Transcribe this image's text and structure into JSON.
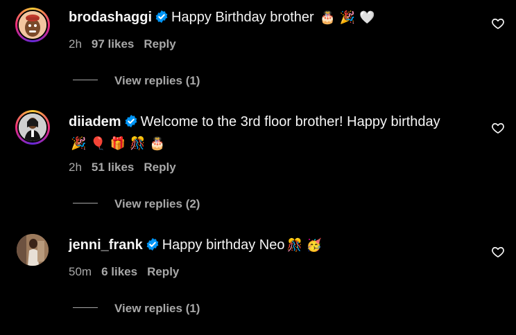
{
  "comments": [
    {
      "username": "brodashaggi",
      "verified": true,
      "text": "Happy Birthday brother",
      "emojis": [
        "🎂",
        "🎉",
        "🤍"
      ],
      "time": "2h",
      "likes": "97 likes",
      "reply_label": "Reply",
      "view_replies": "View replies (1)",
      "avatar_icon": "cartoon-avatar"
    },
    {
      "username": "diiadem",
      "verified": true,
      "text": "Welcome to the 3rd floor brother! Happy birthday",
      "emojis": [
        "🎉",
        "🎈",
        "🎁",
        "🎊",
        "🎂"
      ],
      "time": "2h",
      "likes": "51 likes",
      "reply_label": "Reply",
      "view_replies": "View replies (2)",
      "avatar_icon": "portrait-avatar"
    },
    {
      "username": "jenni_frank",
      "verified": true,
      "text": "Happy birthday Neo",
      "emojis": [
        "🎊",
        "🥳"
      ],
      "time": "50m",
      "likes": "6 likes",
      "reply_label": "Reply",
      "view_replies": "View replies (1)",
      "avatar_icon": "photo-avatar"
    }
  ],
  "colors": {
    "background": "#000000",
    "primary_text": "#f5f5f5",
    "secondary_text": "#a8a8a8",
    "verified_blue": "#0095f6"
  }
}
